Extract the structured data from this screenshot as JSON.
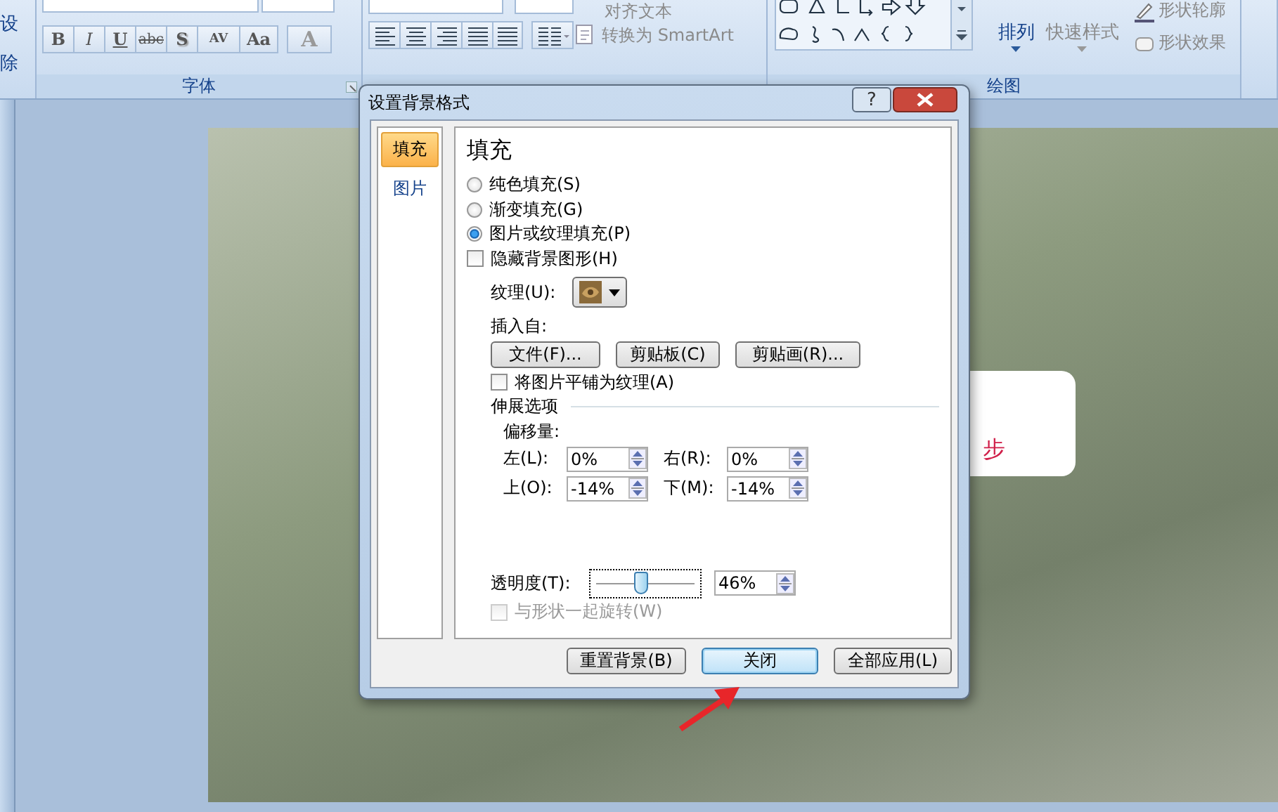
{
  "ribbon": {
    "edge_labels": [
      "设",
      "除"
    ],
    "font_group": {
      "label": "字体",
      "buttons": [
        {
          "glyph": "B",
          "kind": "bold"
        },
        {
          "glyph": "I",
          "kind": "italic"
        },
        {
          "glyph": "U",
          "kind": "underline"
        },
        {
          "glyph": "abc",
          "kind": "strike"
        },
        {
          "glyph": "S",
          "kind": "shadow"
        },
        {
          "glyph": "AV",
          "kind": "spacing"
        },
        {
          "glyph": "Aa",
          "kind": "case"
        }
      ],
      "color_button": "A"
    },
    "paragraph_group": {
      "align_text": "对齐文本",
      "convert": "转换为 SmartArt"
    },
    "drawing_group": {
      "label": "绘图",
      "arrange": "排列",
      "quick_styles": "快速样式",
      "outline": "形状轮廓",
      "effects": "形状效果"
    }
  },
  "slide": {
    "text": "步"
  },
  "dialog": {
    "title": "设置背景格式",
    "help_button": "?",
    "nav": [
      {
        "label": "填充",
        "selected": true
      },
      {
        "label": "图片",
        "selected": false
      }
    ],
    "heading": "填充",
    "fill_options": [
      {
        "label": "纯色填充(S)",
        "selected": false
      },
      {
        "label": "渐变填充(G)",
        "selected": false
      },
      {
        "label": "图片或纹理填充(P)",
        "selected": true
      }
    ],
    "hide_graphics": {
      "label": "隐藏背景图形(H)",
      "checked": false
    },
    "texture": {
      "label": "纹理(U):"
    },
    "insert_from": {
      "label": "插入自:",
      "buttons": [
        "文件(F)...",
        "剪贴板(C)",
        "剪贴画(R)..."
      ]
    },
    "tile": {
      "label": "将图片平铺为纹理(A)",
      "checked": false
    },
    "stretch": {
      "heading": "伸展选项",
      "offset_label": "偏移量:",
      "offsets": [
        {
          "label": "左(L):",
          "value": "0%"
        },
        {
          "label": "右(R):",
          "value": "0%"
        },
        {
          "label": "上(O):",
          "value": "-14%"
        },
        {
          "label": "下(M):",
          "value": "-14%"
        }
      ]
    },
    "transparency": {
      "label": "透明度(T):",
      "level": 0.46,
      "value": "46%"
    },
    "rotate": {
      "label": "与形状一起旋转(W)",
      "checked": false,
      "disabled": true
    },
    "buttons": [
      {
        "label": "重置背景(B)",
        "focused": false
      },
      {
        "label": "关闭",
        "focused": true
      },
      {
        "label": "全部应用(L)",
        "focused": false
      }
    ]
  }
}
